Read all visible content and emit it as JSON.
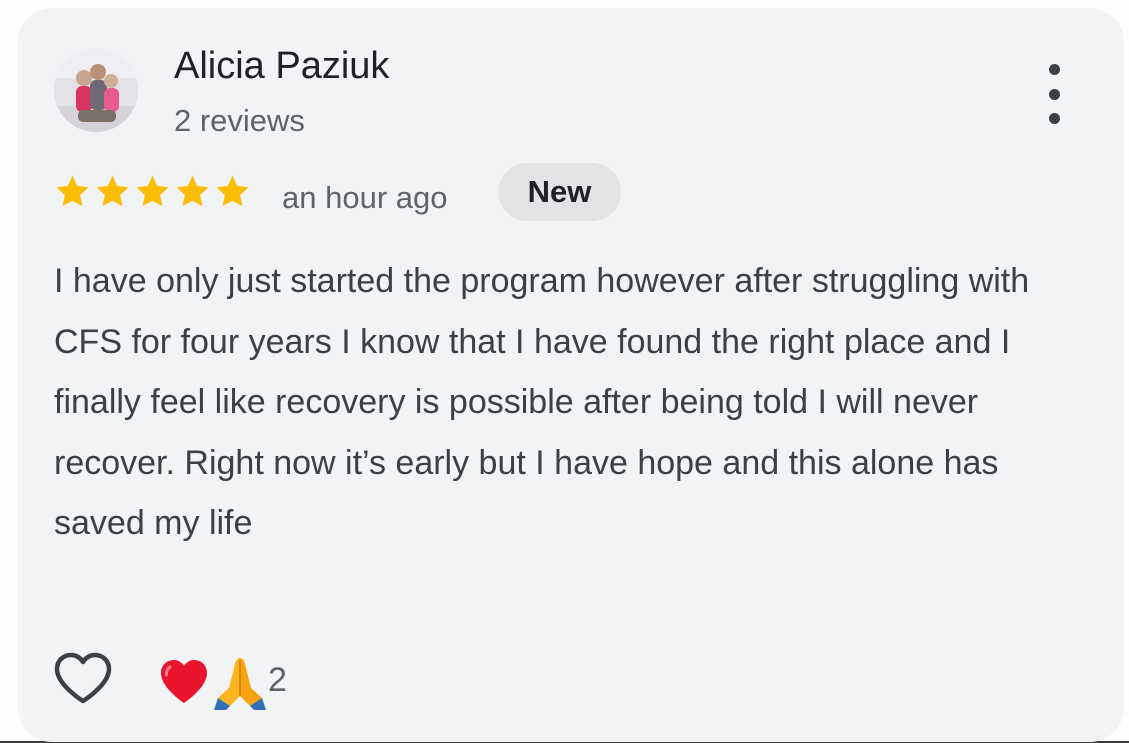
{
  "review": {
    "author": "Alicia Paziuk",
    "review_count": "2 reviews",
    "rating": 5,
    "max_rating": 5,
    "time_ago": "an hour ago",
    "badge": "New",
    "text": "I have only just started the program however after struggling with CFS for four years I know that I have found the right place and I finally feel like recovery is possible after being told I will never recover. Right now it’s early but I have hope and this alone has saved my life",
    "reactions": {
      "icons": [
        "red-heart-emoji",
        "folded-hands-emoji"
      ],
      "count": "2"
    }
  },
  "colors": {
    "star": "#fbbc04",
    "card_background": "#f2f3f5",
    "badge_background": "#e2e3e5"
  }
}
